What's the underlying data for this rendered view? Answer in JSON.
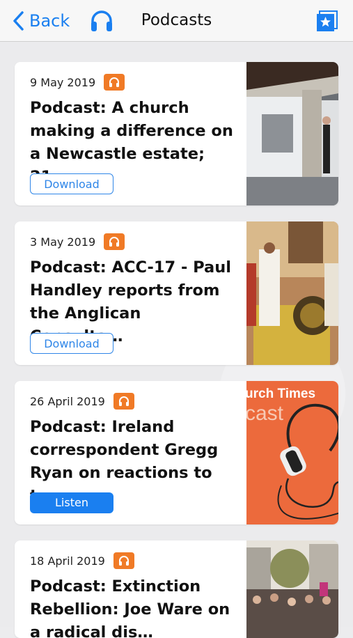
{
  "nav": {
    "back_label": "Back",
    "title": "Podcasts"
  },
  "icons": {
    "back": "chevron-left-icon",
    "headphones": "headphones-icon",
    "favourites": "star-bookmark-icon",
    "podcast_badge": "headphones-badge-icon"
  },
  "colors": {
    "accent": "#1a7ff0",
    "badge": "#f07a26"
  },
  "items": [
    {
      "date": "9 May 2019",
      "title": "Podcast: A church making a difference on a Newcastle estate; 21…",
      "button": "Download",
      "button_style": "outline"
    },
    {
      "date": "3 May 2019",
      "title": "Podcast: ACC-17 - Paul Handley reports from the Anglican Consulta…",
      "button": "Download",
      "button_style": "outline"
    },
    {
      "date": "26 April 2019",
      "title": "Podcast: Ireland correspondent Gregg Ryan on reactions to t…",
      "button": "Listen",
      "button_style": "solid",
      "thumb_text_1": "urch Times",
      "thumb_text_2": "cast"
    },
    {
      "date": "18 April 2019",
      "title": "Podcast: Extinction Rebellion: Joe Ware on a radical dis…",
      "button": "",
      "button_style": "none"
    }
  ]
}
